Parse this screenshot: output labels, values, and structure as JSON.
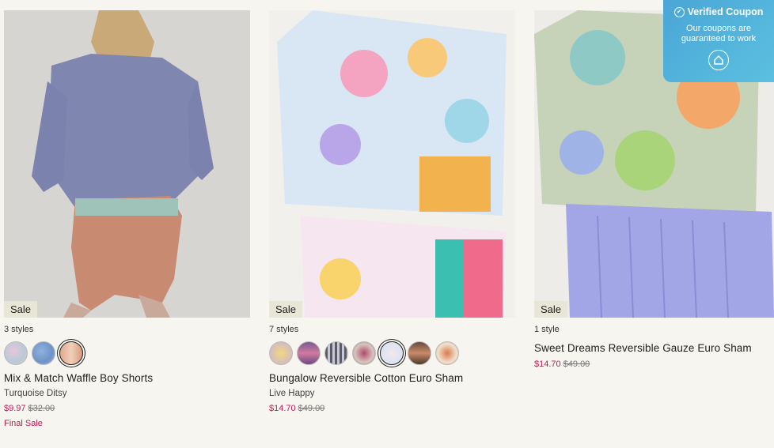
{
  "products": [
    {
      "badge": "Sale",
      "styles": "3 styles",
      "title": "Mix & Match Waffle Boy Shorts",
      "subtitle": "Turquoise Ditsy",
      "price": "$9.97",
      "original_price": "$32.00",
      "note": "Final Sale"
    },
    {
      "badge": "Sale",
      "styles": "7 styles",
      "title": "Bungalow Reversible Cotton Euro Sham",
      "subtitle": "Live Happy",
      "price": "$14.70",
      "original_price": "$49.00"
    },
    {
      "badge": "Sale",
      "styles": "1 style",
      "title": "Sweet Dreams Reversible Gauze Euro Sham",
      "price": "$14.70",
      "original_price": "$49.00"
    }
  ],
  "coupon": {
    "title": "Verified Coupon",
    "line1": "Our coupons are",
    "line2": "guaranteed to work"
  },
  "colors": {
    "sale_price": "#c2185b",
    "badge_bg": "#e8e6d6",
    "coupon_bg": "#4aa6d6"
  }
}
